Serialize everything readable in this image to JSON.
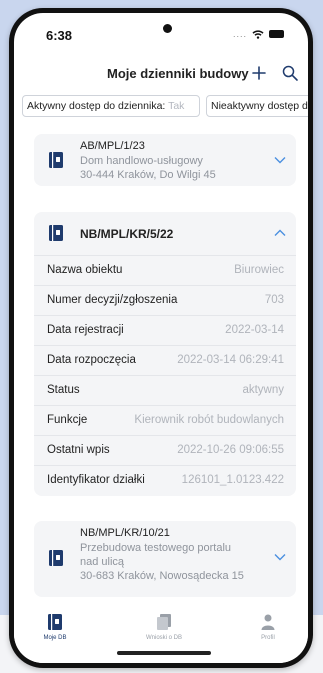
{
  "status": {
    "time": "6:38",
    "dots": "...."
  },
  "header": {
    "title": "Moje dzienniki budowy"
  },
  "filters": {
    "active_label": "Aktywny dostęp do dziennika:",
    "active_placeholder": "Tak",
    "inactive_label": "Nieaktywny dostęp d"
  },
  "cards": [
    {
      "code": "AB/MPL/1/23",
      "lines": [
        "Dom handlowo-usługowy",
        "30-444 Kraków, Do Wilgi 45"
      ],
      "expanded": false
    },
    {
      "code": "NB/MPL/KR/5/22",
      "expanded": true,
      "details": [
        {
          "label": "Nazwa obiektu",
          "value": "Biurowiec"
        },
        {
          "label": "Numer decyzji/zgłoszenia",
          "value": "703"
        },
        {
          "label": "Data rejestracji",
          "value": "2022-03-14"
        },
        {
          "label": "Data rozpoczęcia",
          "value": "2022-03-14 06:29:41"
        },
        {
          "label": "Status",
          "value": "aktywny"
        },
        {
          "label": "Funkcje",
          "value": "Kierownik robót budowlanych"
        },
        {
          "label": "Ostatni wpis",
          "value": "2022-10-26 09:06:55"
        },
        {
          "label": "Identyfikator działki",
          "value": "126101_1.0123.422"
        }
      ]
    },
    {
      "code": "NB/MPL/KR/10/21",
      "lines": [
        "Przebudowa testowego portalu",
        "nad ulicą",
        "30-683 Kraków, Nowosądecka 15"
      ],
      "expanded": false
    }
  ],
  "tabs": [
    {
      "label": "Moje DB",
      "active": true
    },
    {
      "label": "Wnioski o DB",
      "active": false
    },
    {
      "label": "Profil",
      "active": false
    }
  ],
  "colors": {
    "accent": "#1f3b6d",
    "muted": "#9aa0a8",
    "chevron": "#4a8fe0"
  }
}
